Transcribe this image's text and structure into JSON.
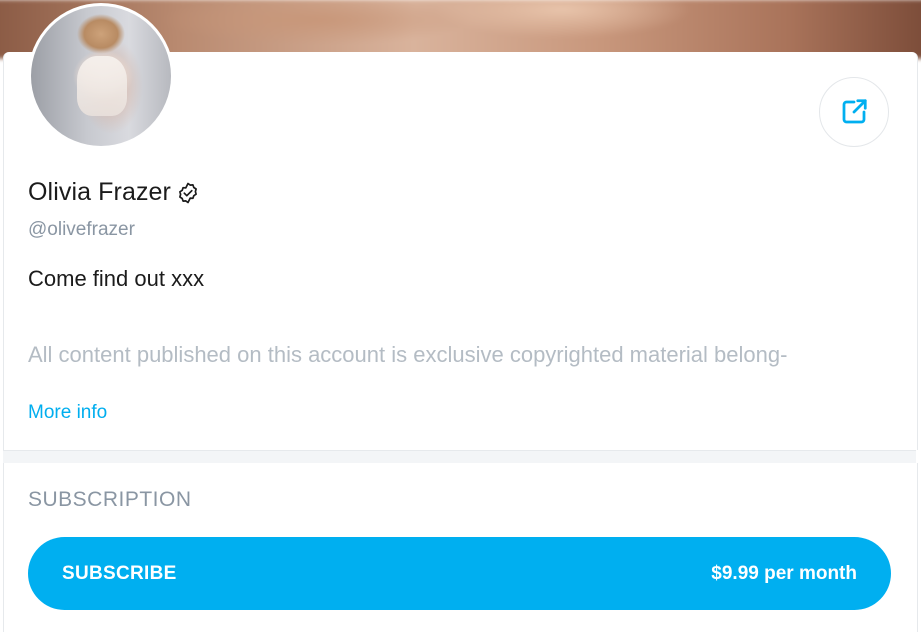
{
  "profile": {
    "name": "Olivia Frazer",
    "handle": "@olivefrazer",
    "bio": "Come find out xxx",
    "about_text": "All content published on this account is exclusive copyrighted material belong-",
    "more_info_label": "More info"
  },
  "subscription": {
    "heading": "SUBSCRIPTION",
    "button_label": "SUBSCRIBE",
    "price": "$9.99 per month"
  },
  "colors": {
    "accent": "#00aff0",
    "muted_text": "#8a96a3"
  },
  "icons": {
    "share": "share-icon",
    "verified": "verified-badge-icon"
  }
}
